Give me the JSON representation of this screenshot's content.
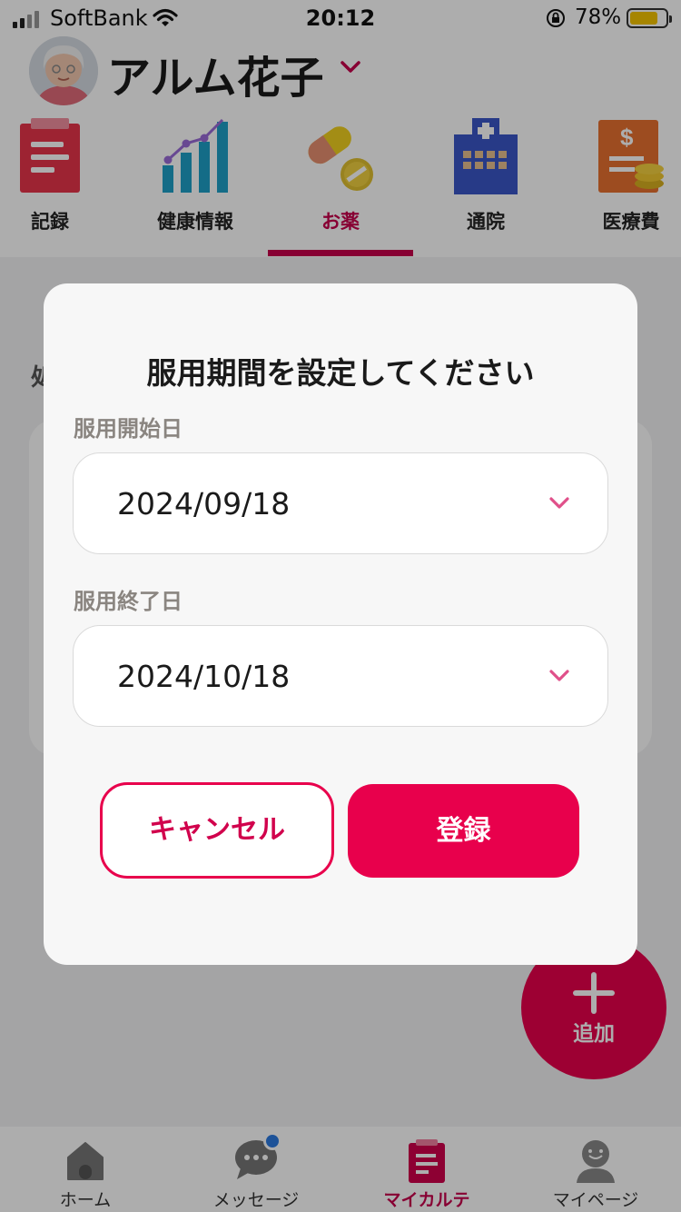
{
  "status_bar": {
    "carrier": "SoftBank",
    "time": "20:12",
    "battery_percent": "78%",
    "battery_level": 0.78,
    "icons": [
      "signal-icon",
      "wifi-icon",
      "orientation-lock-icon",
      "battery-icon"
    ]
  },
  "profile": {
    "name": "アルム花子",
    "avatar_icon": "elderly-woman-avatar",
    "chevron_icon": "chevron-down-icon"
  },
  "tabs": [
    {
      "label": "記録",
      "icon": "clipboard-icon"
    },
    {
      "label": "健康情報",
      "icon": "chart-icon"
    },
    {
      "label": "お薬",
      "icon": "pills-icon",
      "active": true
    },
    {
      "label": "通院",
      "icon": "hospital-icon"
    },
    {
      "label": "医療費",
      "icon": "money-document-icon"
    }
  ],
  "background": {
    "partial_text": "処"
  },
  "fab": {
    "label": "追加",
    "icon": "plus-icon"
  },
  "bottom_nav": [
    {
      "label": "ホーム",
      "icon": "home-icon"
    },
    {
      "label": "メッセージ",
      "icon": "chat-bubble-icon",
      "badge": true
    },
    {
      "label": "マイカルテ",
      "icon": "clipboard-icon",
      "active": true
    },
    {
      "label": "マイページ",
      "icon": "person-icon"
    }
  ],
  "modal": {
    "title": "服用期間を設定してください",
    "start_label": "服用開始日",
    "start_value": "2024/09/18",
    "end_label": "服用終了日",
    "end_value": "2024/10/18",
    "cancel_label": "キャンセル",
    "submit_label": "登録"
  },
  "colors": {
    "accent": "#e8004c",
    "accent_dark": "#c8004c",
    "label_gray": "#8a8580",
    "badge_blue": "#2c7ae0"
  }
}
